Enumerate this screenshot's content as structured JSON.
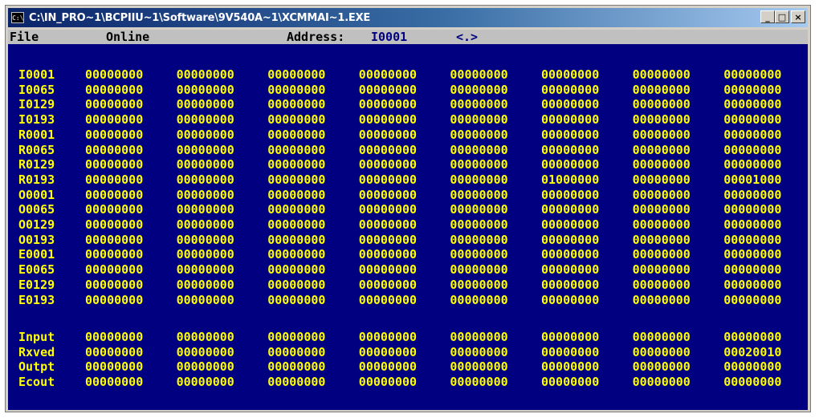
{
  "window": {
    "title": "C:\\IN_PRO~1\\BCPIIU~1\\Software\\9V540A~1\\XCMMAI~1.EXE",
    "icon": "C:\\",
    "buttons": {
      "minimize": "_",
      "maximize": "□",
      "close": "×"
    }
  },
  "menu": {
    "file": "File",
    "online": "Online",
    "address_label": "Address:",
    "address_value": "I0001",
    "nav": "<.>"
  },
  "rows": [
    {
      "label": "I0001",
      "values": [
        "00000000",
        "00000000",
        "00000000",
        "00000000",
        "00000000",
        "00000000",
        "00000000",
        "00000000"
      ]
    },
    {
      "label": "I0065",
      "values": [
        "00000000",
        "00000000",
        "00000000",
        "00000000",
        "00000000",
        "00000000",
        "00000000",
        "00000000"
      ]
    },
    {
      "label": "I0129",
      "values": [
        "00000000",
        "00000000",
        "00000000",
        "00000000",
        "00000000",
        "00000000",
        "00000000",
        "00000000"
      ]
    },
    {
      "label": "I0193",
      "values": [
        "00000000",
        "00000000",
        "00000000",
        "00000000",
        "00000000",
        "00000000",
        "00000000",
        "00000000"
      ]
    },
    {
      "label": "R0001",
      "values": [
        "00000000",
        "00000000",
        "00000000",
        "00000000",
        "00000000",
        "00000000",
        "00000000",
        "00000000"
      ]
    },
    {
      "label": "R0065",
      "values": [
        "00000000",
        "00000000",
        "00000000",
        "00000000",
        "00000000",
        "00000000",
        "00000000",
        "00000000"
      ]
    },
    {
      "label": "R0129",
      "values": [
        "00000000",
        "00000000",
        "00000000",
        "00000000",
        "00000000",
        "00000000",
        "00000000",
        "00000000"
      ]
    },
    {
      "label": "R0193",
      "values": [
        "00000000",
        "00000000",
        "00000000",
        "00000000",
        "00000000",
        "01000000",
        "00000000",
        "00001000"
      ]
    },
    {
      "label": "O0001",
      "values": [
        "00000000",
        "00000000",
        "00000000",
        "00000000",
        "00000000",
        "00000000",
        "00000000",
        "00000000"
      ]
    },
    {
      "label": "O0065",
      "values": [
        "00000000",
        "00000000",
        "00000000",
        "00000000",
        "00000000",
        "00000000",
        "00000000",
        "00000000"
      ]
    },
    {
      "label": "O0129",
      "values": [
        "00000000",
        "00000000",
        "00000000",
        "00000000",
        "00000000",
        "00000000",
        "00000000",
        "00000000"
      ]
    },
    {
      "label": "O0193",
      "values": [
        "00000000",
        "00000000",
        "00000000",
        "00000000",
        "00000000",
        "00000000",
        "00000000",
        "00000000"
      ]
    },
    {
      "label": "E0001",
      "values": [
        "00000000",
        "00000000",
        "00000000",
        "00000000",
        "00000000",
        "00000000",
        "00000000",
        "00000000"
      ]
    },
    {
      "label": "E0065",
      "values": [
        "00000000",
        "00000000",
        "00000000",
        "00000000",
        "00000000",
        "00000000",
        "00000000",
        "00000000"
      ]
    },
    {
      "label": "E0129",
      "values": [
        "00000000",
        "00000000",
        "00000000",
        "00000000",
        "00000000",
        "00000000",
        "00000000",
        "00000000"
      ]
    },
    {
      "label": "E0193",
      "values": [
        "00000000",
        "00000000",
        "00000000",
        "00000000",
        "00000000",
        "00000000",
        "00000000",
        "00000000"
      ]
    }
  ],
  "summary_rows": [
    {
      "label": "Input",
      "values": [
        "00000000",
        "00000000",
        "00000000",
        "00000000",
        "00000000",
        "00000000",
        "00000000",
        "00000000"
      ]
    },
    {
      "label": "Rxved",
      "values": [
        "00000000",
        "00000000",
        "00000000",
        "00000000",
        "00000000",
        "00000000",
        "00000000",
        "00020010"
      ]
    },
    {
      "label": "Outpt",
      "values": [
        "00000000",
        "00000000",
        "00000000",
        "00000000",
        "00000000",
        "00000000",
        "00000000",
        "00000000"
      ]
    },
    {
      "label": "Ecout",
      "values": [
        "00000000",
        "00000000",
        "00000000",
        "00000000",
        "00000000",
        "00000000",
        "00000000",
        "00000000"
      ]
    }
  ],
  "colors": {
    "console_bg": "#000080",
    "text": "#ffff00",
    "menubar_bg": "#c0c0c0",
    "titlebar_start": "#0a246a"
  }
}
